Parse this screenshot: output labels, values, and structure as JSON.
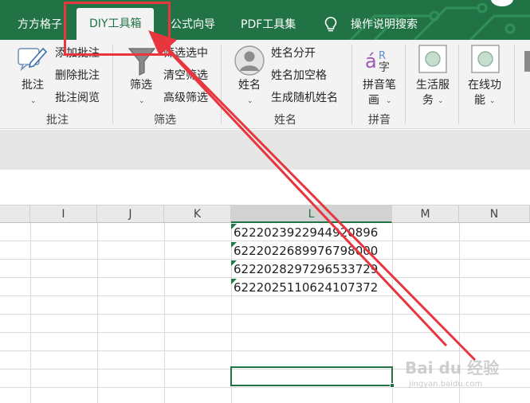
{
  "tabs": [
    {
      "label": "方方格子",
      "active": false
    },
    {
      "label": "DIY工具箱",
      "active": true
    },
    {
      "label": "公式向导",
      "active": false
    },
    {
      "label": "PDF工具集",
      "active": false
    }
  ],
  "search_tab": {
    "label": "操作说明搜索",
    "icon": "lightbulb-icon"
  },
  "ribbon": {
    "groups": {
      "annotate": "批注",
      "filter": "筛选",
      "name": "姓名",
      "pinyin": "拼音"
    },
    "annotate": {
      "big_button": "批注",
      "items": [
        "添加批注",
        "删除批注",
        "批注阅览"
      ]
    },
    "filter": {
      "big_button": "筛选",
      "items": [
        "筛选选中",
        "清空筛选",
        "高级筛选"
      ]
    },
    "name": {
      "big_button": "姓名",
      "items": [
        "姓名分开",
        "姓名加空格",
        "生成随机姓名"
      ]
    },
    "pinyin": {
      "big_button_line1": "拼音笔",
      "big_button_line2": "画"
    },
    "life": {
      "line1": "生活服",
      "line2": "务"
    },
    "online": {
      "line1": "在线功",
      "line2": "能"
    }
  },
  "columns": [
    "I",
    "J",
    "K",
    "L",
    "M",
    "N"
  ],
  "selected_column": "L",
  "cells": [
    "6222023922944920896",
    "6222022689976798000",
    "6222028297296533729",
    "6222025110624107372"
  ],
  "accent_color": "#217346",
  "annotation_color": "#e8363f",
  "watermark": {
    "brand": "Bai du 经验",
    "url": "jingyan.baidu.com"
  }
}
